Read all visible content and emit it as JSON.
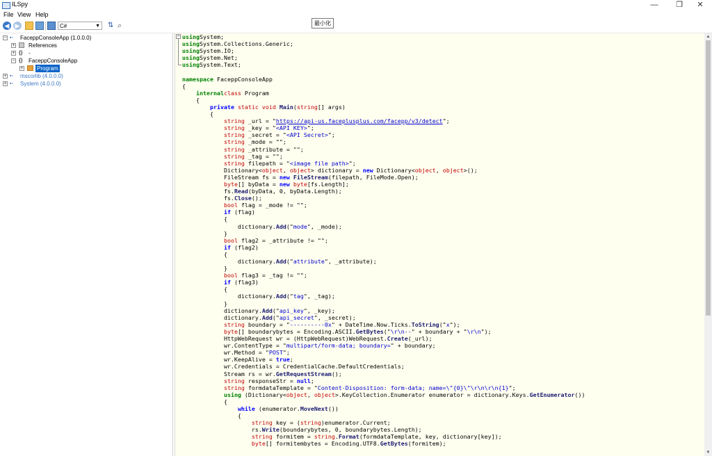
{
  "window": {
    "title": "ILSpy",
    "controls": [
      "—",
      "❐",
      "✕"
    ]
  },
  "menu": [
    "File",
    "View",
    "Help"
  ],
  "toolbar": {
    "language": "C#",
    "tooltip": "最小化",
    "icons": [
      "back-icon",
      "forward-icon",
      "open-icon",
      "reload-icon",
      "show-public-icon",
      "sort-icon",
      "search-icon"
    ]
  },
  "tree": {
    "nodes": [
      {
        "label": "FaceppConsoleApp (1.0.0.0)",
        "expander": "⊟",
        "icon": "assembly"
      },
      {
        "label": "References",
        "expander": "⊞",
        "icon": "references"
      },
      {
        "label": "-",
        "expander": "⊞",
        "icon": "namespace"
      },
      {
        "label": "FaceppConsoleApp",
        "expander": "⊟",
        "icon": "namespace"
      },
      {
        "label": "Program",
        "expander": "⊞",
        "icon": "class",
        "selected": true
      },
      {
        "label": "mscorlib (4.0.0.0)",
        "expander": "⊞",
        "icon": "assembly"
      },
      {
        "label": "System (4.0.0.0)",
        "expander": "⊞",
        "icon": "assembly"
      }
    ]
  },
  "colors": {
    "selection": "#0a64c8",
    "editor_bg": "#fffff0",
    "keyword_green": "#008000",
    "keyword_blue": "#0000ff",
    "type_red": "#c00000",
    "string_blue": "#0000cd"
  },
  "code": {
    "lines": [
      [
        [
          "kw",
          "using"
        ],
        [
          "",
          "System;"
        ]
      ],
      [
        [
          "kw",
          "using"
        ],
        [
          "",
          "System.Collections.Generic;"
        ]
      ],
      [
        [
          "kw",
          "using"
        ],
        [
          "",
          "System.IO;"
        ]
      ],
      [
        [
          "kw",
          "using"
        ],
        [
          "",
          "System.Net;"
        ]
      ],
      [
        [
          "kw",
          "using"
        ],
        [
          "",
          "System.Text;"
        ]
      ],
      [],
      [
        [
          "kw",
          "namespace"
        ],
        [
          "",
          " FaceppConsoleApp"
        ]
      ],
      [
        [
          "",
          "{"
        ]
      ],
      [
        [
          "",
          "    "
        ],
        [
          "kw",
          "internal"
        ],
        [
          "",
          ""
        ],
        [
          "r",
          "class"
        ],
        [
          "",
          " Program"
        ]
      ],
      [
        [
          "",
          "    {"
        ]
      ],
      [
        [
          "",
          "        "
        ],
        [
          "b",
          "private"
        ],
        [
          "",
          " "
        ],
        [
          "r",
          "static"
        ],
        [
          "",
          " "
        ],
        [
          "r",
          "void"
        ],
        [
          "",
          " "
        ],
        [
          "m",
          "Main"
        ],
        [
          "",
          "("
        ],
        [
          "r",
          "string"
        ],
        [
          "",
          "[] args)"
        ]
      ],
      [
        [
          "",
          "        {"
        ]
      ],
      [
        [
          "",
          "            "
        ],
        [
          "r",
          "string"
        ],
        [
          "",
          " _url = \""
        ],
        [
          "u",
          "https://api-us.faceplusplus.com/facepp/v3/detect"
        ],
        [
          "",
          "\";"
        ]
      ],
      [
        [
          "",
          "            "
        ],
        [
          "r",
          "string"
        ],
        [
          "",
          " _key = \""
        ],
        [
          "s",
          "<API KEY>"
        ],
        [
          "",
          "\";"
        ]
      ],
      [
        [
          "",
          "            "
        ],
        [
          "r",
          "string"
        ],
        [
          "",
          " _secret = \""
        ],
        [
          "s",
          "<API Secret>"
        ],
        [
          "",
          "\";"
        ]
      ],
      [
        [
          "",
          "            "
        ],
        [
          "r",
          "string"
        ],
        [
          "",
          " _mode = \"\";"
        ]
      ],
      [
        [
          "",
          "            "
        ],
        [
          "r",
          "string"
        ],
        [
          "",
          " _attribute = \"\";"
        ]
      ],
      [
        [
          "",
          "            "
        ],
        [
          "r",
          "string"
        ],
        [
          "",
          " _tag = \"\";"
        ]
      ],
      [
        [
          "",
          "            "
        ],
        [
          "r",
          "string"
        ],
        [
          "",
          " filepath = \""
        ],
        [
          "s",
          "<image file path>"
        ],
        [
          "",
          "\";"
        ]
      ],
      [
        [
          "",
          "            Dictionary<"
        ],
        [
          "r",
          "object"
        ],
        [
          "",
          ", "
        ],
        [
          "r",
          "object"
        ],
        [
          "",
          "> dictionary = "
        ],
        [
          "b",
          "new"
        ],
        [
          "",
          " Dictionary<"
        ],
        [
          "r",
          "object"
        ],
        [
          "",
          ", "
        ],
        [
          "r",
          "object"
        ],
        [
          "",
          ">();"
        ]
      ],
      [
        [
          "",
          "            FileStream fs = "
        ],
        [
          "b",
          "new"
        ],
        [
          "",
          " "
        ],
        [
          "m",
          "FileStream"
        ],
        [
          "",
          "(filepath, FileMode.Open);"
        ]
      ],
      [
        [
          "",
          "            "
        ],
        [
          "r",
          "byte"
        ],
        [
          "",
          "[] byData = "
        ],
        [
          "b",
          "new"
        ],
        [
          "",
          " "
        ],
        [
          "r",
          "byte"
        ],
        [
          "",
          "[fs.Length];"
        ]
      ],
      [
        [
          "",
          "            fs."
        ],
        [
          "m",
          "Read"
        ],
        [
          "",
          "(byData, 0, byData.Length);"
        ]
      ],
      [
        [
          "",
          "            fs."
        ],
        [
          "m",
          "Close"
        ],
        [
          "",
          "();"
        ]
      ],
      [
        [
          "",
          "            "
        ],
        [
          "r",
          "bool"
        ],
        [
          "",
          " flag = _mode != \"\";"
        ]
      ],
      [
        [
          "",
          "            "
        ],
        [
          "b",
          "if"
        ],
        [
          "",
          " (flag)"
        ]
      ],
      [
        [
          "",
          "            {"
        ]
      ],
      [
        [
          "",
          "                dictionary."
        ],
        [
          "m",
          "Add"
        ],
        [
          "",
          "(\""
        ],
        [
          "s",
          "mode"
        ],
        [
          "",
          "\", _mode);"
        ]
      ],
      [
        [
          "",
          "            }"
        ]
      ],
      [
        [
          "",
          "            "
        ],
        [
          "r",
          "bool"
        ],
        [
          "",
          " flag2 = _attribute != \"\";"
        ]
      ],
      [
        [
          "",
          "            "
        ],
        [
          "b",
          "if"
        ],
        [
          "",
          " (flag2)"
        ]
      ],
      [
        [
          "",
          "            {"
        ]
      ],
      [
        [
          "",
          "                dictionary."
        ],
        [
          "m",
          "Add"
        ],
        [
          "",
          "(\""
        ],
        [
          "s",
          "attribute"
        ],
        [
          "",
          "\", _attribute);"
        ]
      ],
      [
        [
          "",
          "            }"
        ]
      ],
      [
        [
          "",
          "            "
        ],
        [
          "r",
          "bool"
        ],
        [
          "",
          " flag3 = _tag != \"\";"
        ]
      ],
      [
        [
          "",
          "            "
        ],
        [
          "b",
          "if"
        ],
        [
          "",
          " (flag3)"
        ]
      ],
      [
        [
          "",
          "            {"
        ]
      ],
      [
        [
          "",
          "                dictionary."
        ],
        [
          "m",
          "Add"
        ],
        [
          "",
          "(\""
        ],
        [
          "s",
          "tag"
        ],
        [
          "",
          "\", _tag);"
        ]
      ],
      [
        [
          "",
          "            }"
        ]
      ],
      [
        [
          "",
          "            dictionary."
        ],
        [
          "m",
          "Add"
        ],
        [
          "",
          "(\""
        ],
        [
          "s",
          "api_key"
        ],
        [
          "",
          "\", _key);"
        ]
      ],
      [
        [
          "",
          "            dictionary."
        ],
        [
          "m",
          "Add"
        ],
        [
          "",
          "(\""
        ],
        [
          "s",
          "api_secret"
        ],
        [
          "",
          "\", _secret);"
        ]
      ],
      [
        [
          "",
          "            "
        ],
        [
          "r",
          "string"
        ],
        [
          "",
          " boundary = \""
        ],
        [
          "s",
          "----------0x"
        ],
        [
          "",
          "\" + DateTime.Now.Ticks."
        ],
        [
          "m",
          "ToString"
        ],
        [
          "",
          "(\""
        ],
        [
          "s",
          "x"
        ],
        [
          "",
          "\");"
        ]
      ],
      [
        [
          "",
          "            "
        ],
        [
          "r",
          "byte"
        ],
        [
          "",
          "[] boundarybytes = Encoding.ASCII."
        ],
        [
          "m",
          "GetBytes"
        ],
        [
          "",
          "(\""
        ],
        [
          "s",
          "\\r\\n--"
        ],
        [
          "",
          "\" + boundary + \""
        ],
        [
          "s",
          "\\r\\n"
        ],
        [
          "",
          "\");"
        ]
      ],
      [
        [
          "",
          "            HttpWebRequest wr = (HttpWebRequest)WebRequest."
        ],
        [
          "m",
          "Create"
        ],
        [
          "",
          "(_url);"
        ]
      ],
      [
        [
          "",
          "            wr.ContentType = \""
        ],
        [
          "s",
          "multipart/form-data; boundary="
        ],
        [
          "",
          "\" + boundary;"
        ]
      ],
      [
        [
          "",
          "            wr.Method = \""
        ],
        [
          "s",
          "POST"
        ],
        [
          "",
          "\";"
        ]
      ],
      [
        [
          "",
          "            wr.KeepAlive = "
        ],
        [
          "b",
          "true"
        ],
        [
          "",
          ";"
        ]
      ],
      [
        [
          "",
          "            wr.Credentials = CredentialCache.DefaultCredentials;"
        ]
      ],
      [
        [
          "",
          "            Stream rs = wr."
        ],
        [
          "m",
          "GetRequestStream"
        ],
        [
          "",
          "();"
        ]
      ],
      [
        [
          "",
          "            "
        ],
        [
          "r",
          "string"
        ],
        [
          "",
          " responseStr = "
        ],
        [
          "b",
          "null"
        ],
        [
          "",
          ";"
        ]
      ],
      [
        [
          "",
          "            "
        ],
        [
          "r",
          "string"
        ],
        [
          "",
          " formdataTemplate = \""
        ],
        [
          "s",
          "Content-Disposition: form-data; name=\\\"{0}\\\"\\r\\n\\r\\n{1}"
        ],
        [
          "",
          "\";"
        ]
      ],
      [
        [
          "",
          "            "
        ],
        [
          "kw",
          "using"
        ],
        [
          "",
          " (Dictionary<"
        ],
        [
          "r",
          "object"
        ],
        [
          "",
          ", "
        ],
        [
          "r",
          "object"
        ],
        [
          "",
          ">.KeyCollection.Enumerator enumerator = dictionary.Keys."
        ],
        [
          "m",
          "GetEnumerator"
        ],
        [
          "",
          "())"
        ]
      ],
      [
        [
          "",
          "            {"
        ]
      ],
      [
        [
          "",
          "                "
        ],
        [
          "b",
          "while"
        ],
        [
          "",
          " (enumerator."
        ],
        [
          "m",
          "MoveNext"
        ],
        [
          "",
          "())"
        ]
      ],
      [
        [
          "",
          "                {"
        ]
      ],
      [
        [
          "",
          "                    "
        ],
        [
          "r",
          "string"
        ],
        [
          "",
          " key = ("
        ],
        [
          "r",
          "string"
        ],
        [
          "",
          ")enumerator.Current;"
        ]
      ],
      [
        [
          "",
          "                    rs."
        ],
        [
          "m",
          "Write"
        ],
        [
          "",
          "(boundarybytes, 0, boundarybytes.Length);"
        ]
      ],
      [
        [
          "",
          "                    "
        ],
        [
          "r",
          "string"
        ],
        [
          "",
          " formitem = "
        ],
        [
          "r",
          "string"
        ],
        [
          "",
          "."
        ],
        [
          "m",
          "Format"
        ],
        [
          "",
          "(formdataTemplate, key, dictionary[key]);"
        ]
      ],
      [
        [
          "",
          "                    "
        ],
        [
          "r",
          "byte"
        ],
        [
          "",
          "[] formitembytes = Encoding.UTF8."
        ],
        [
          "m",
          "GetBytes"
        ],
        [
          "",
          "(formitem);"
        ]
      ]
    ]
  }
}
